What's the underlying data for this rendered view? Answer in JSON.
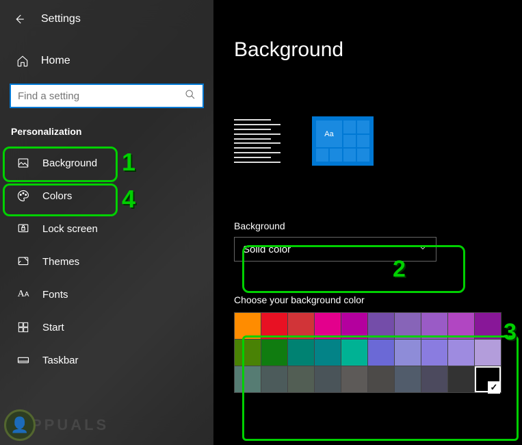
{
  "app": {
    "title": "Settings"
  },
  "sidebar": {
    "home": "Home",
    "search_placeholder": "Find a setting",
    "section": "Personalization",
    "items": [
      {
        "label": "Background"
      },
      {
        "label": "Colors"
      },
      {
        "label": "Lock screen"
      },
      {
        "label": "Themes"
      },
      {
        "label": "Fonts"
      },
      {
        "label": "Start"
      },
      {
        "label": "Taskbar"
      }
    ]
  },
  "main": {
    "title": "Background",
    "preview_tile_text": "Aa",
    "bg_label": "Background",
    "bg_value": "Solid color",
    "color_label": "Choose your background color",
    "colors_row1": [
      "#ff8c00",
      "#e81123",
      "#d13438",
      "#e3008c",
      "#b4009e",
      "#744da9",
      "#8764b8",
      "#9a5bc6",
      "#b146c2",
      "#881798"
    ],
    "colors_row2": [
      "#498205",
      "#107c10",
      "#008272",
      "#038387",
      "#00b294",
      "#6b69d6",
      "#8e8cd8",
      "#8a7ce0",
      "#9e8be0",
      "#b39ddb"
    ],
    "colors_row3": [
      "#567c73",
      "#4c5b5b",
      "#525e54",
      "#4a5459",
      "#5d5a58",
      "#4c4a48",
      "#515c6b",
      "#4c4a5e",
      "#333333",
      "#000000"
    ],
    "selected_color_index": 29
  },
  "annotations": {
    "n1": "1",
    "n2": "2",
    "n3": "3",
    "n4": "4"
  },
  "watermark": {
    "text": "PPUALS"
  }
}
